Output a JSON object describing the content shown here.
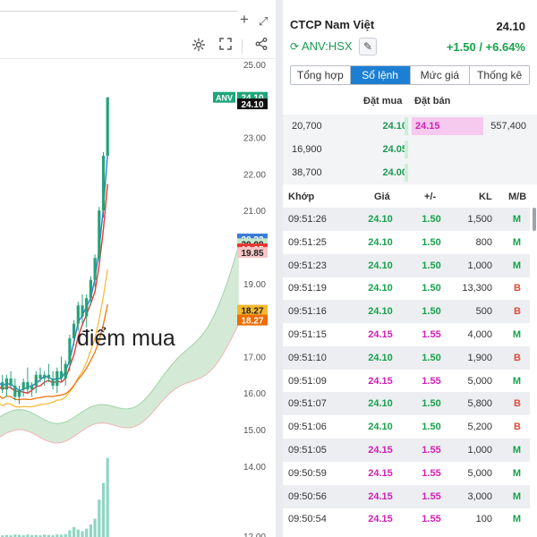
{
  "chart_area": {
    "icons": [
      "plus-icon",
      "expand-icon",
      "settings-icon",
      "fullscreen-icon",
      "share-icon"
    ],
    "annotation": "điểm mua"
  },
  "chart_data": {
    "type": "candlestick",
    "ylim": [
      12.0,
      25.0
    ],
    "y_ticks": [
      "25.00",
      "24.10",
      "23.00",
      "22.00",
      "21.00",
      "20.22",
      "20.09",
      "19.95",
      "19.85",
      "19.00",
      "18.27",
      "18.27",
      "17.00",
      "16.00",
      "15.00",
      "14.00"
    ],
    "price_labels": [
      {
        "text": "24.10",
        "value": 24.1,
        "color": "#1ea67a"
      },
      {
        "text": "24.10",
        "value": 23.92,
        "color": "#111111"
      },
      {
        "text": "20.22",
        "value": 20.22,
        "color": "#3a7bd5"
      },
      {
        "text": "20.09",
        "value": 20.09,
        "color": "#c8e6c9"
      },
      {
        "text": "19.95",
        "value": 19.95,
        "color": "#e53935"
      },
      {
        "text": "19.85",
        "value": 19.85,
        "color": "#f7c6c6"
      },
      {
        "text": "18.27",
        "value": 18.27,
        "color": "#f5b82e"
      },
      {
        "text": "18.27",
        "value": 18.0,
        "color": "#ef6c00"
      }
    ],
    "legend_tag": {
      "text": "ANV",
      "color": "#1ea67a"
    },
    "candles": [
      {
        "o": 16.1,
        "h": 16.4,
        "l": 15.9,
        "c": 16.3
      },
      {
        "o": 16.3,
        "h": 16.5,
        "l": 16.0,
        "c": 16.1
      },
      {
        "o": 16.1,
        "h": 16.5,
        "l": 15.9,
        "c": 16.4
      },
      {
        "o": 16.4,
        "h": 16.6,
        "l": 16.1,
        "c": 16.2
      },
      {
        "o": 16.2,
        "h": 16.4,
        "l": 15.8,
        "c": 15.9
      },
      {
        "o": 15.9,
        "h": 16.2,
        "l": 15.7,
        "c": 16.1
      },
      {
        "o": 16.1,
        "h": 16.4,
        "l": 15.9,
        "c": 16.3
      },
      {
        "o": 16.3,
        "h": 16.7,
        "l": 16.0,
        "c": 16.1
      },
      {
        "o": 16.1,
        "h": 16.3,
        "l": 15.9,
        "c": 16.2
      },
      {
        "o": 16.2,
        "h": 16.6,
        "l": 16.0,
        "c": 16.5
      },
      {
        "o": 16.5,
        "h": 16.7,
        "l": 16.3,
        "c": 16.4
      },
      {
        "o": 16.4,
        "h": 16.6,
        "l": 16.2,
        "c": 16.5
      },
      {
        "o": 16.5,
        "h": 16.8,
        "l": 16.3,
        "c": 16.4
      },
      {
        "o": 16.4,
        "h": 16.6,
        "l": 16.1,
        "c": 16.2
      },
      {
        "o": 16.2,
        "h": 16.7,
        "l": 16.0,
        "c": 16.6
      },
      {
        "o": 16.6,
        "h": 17.0,
        "l": 16.3,
        "c": 16.4
      },
      {
        "o": 16.4,
        "h": 16.9,
        "l": 16.2,
        "c": 16.8
      },
      {
        "o": 16.8,
        "h": 17.6,
        "l": 16.6,
        "c": 17.5
      },
      {
        "o": 17.5,
        "h": 18.0,
        "l": 17.3,
        "c": 17.9
      },
      {
        "o": 17.9,
        "h": 18.5,
        "l": 17.7,
        "c": 18.4
      },
      {
        "o": 18.4,
        "h": 18.7,
        "l": 17.9,
        "c": 18.1
      },
      {
        "o": 18.1,
        "h": 18.7,
        "l": 17.8,
        "c": 18.6
      },
      {
        "o": 18.6,
        "h": 19.2,
        "l": 18.4,
        "c": 19.1
      },
      {
        "o": 19.1,
        "h": 19.8,
        "l": 18.9,
        "c": 19.7
      },
      {
        "o": 19.7,
        "h": 21.1,
        "l": 19.6,
        "c": 21.0
      },
      {
        "o": 21.0,
        "h": 22.6,
        "l": 20.8,
        "c": 22.5
      },
      {
        "o": 22.5,
        "h": 24.1,
        "l": 22.5,
        "c": 24.1
      }
    ],
    "volumes": [
      0.3,
      0.2,
      0.25,
      0.2,
      0.3,
      0.25,
      0.2,
      0.3,
      0.22,
      0.25,
      0.2,
      0.3,
      0.25,
      0.2,
      0.3,
      0.28,
      0.35,
      0.8,
      1.2,
      0.9,
      0.7,
      1.0,
      1.5,
      2.2,
      4.5,
      6.5,
      9.5
    ]
  },
  "quote": {
    "company_name": "CTCP Nam Việt",
    "last_price": "24.10",
    "ticker": "ANV:HSX",
    "change": "+1.50 / +6.64%"
  },
  "tabs": [
    {
      "label": "Tổng hợp",
      "active": false
    },
    {
      "label": "Sổ lệnh",
      "active": true
    },
    {
      "label": "Mức giá",
      "active": false
    },
    {
      "label": "Thống kê",
      "active": false
    }
  ],
  "order_book": {
    "bid_header": "Đặt mua",
    "ask_header": "Đặt bán",
    "rows": [
      {
        "bid_qty": "20,700",
        "bid_price": "24.10",
        "ask_price": "24.15",
        "ask_qty": "557,400"
      },
      {
        "bid_qty": "16,900",
        "bid_price": "24.05",
        "ask_price": "",
        "ask_qty": ""
      },
      {
        "bid_qty": "38,700",
        "bid_price": "24.00",
        "ask_price": "",
        "ask_qty": ""
      }
    ]
  },
  "trades": {
    "headers": [
      "Khớp",
      "Giá",
      "+/-",
      "KL",
      "M/B"
    ],
    "rows": [
      {
        "time": "09:51:26",
        "price": "24.10",
        "change": "1.50",
        "volume": "1,500",
        "side": "M"
      },
      {
        "time": "09:51:25",
        "price": "24.10",
        "change": "1.50",
        "volume": "800",
        "side": "M"
      },
      {
        "time": "09:51:23",
        "price": "24.10",
        "change": "1.50",
        "volume": "1,000",
        "side": "M"
      },
      {
        "time": "09:51:19",
        "price": "24.10",
        "change": "1.50",
        "volume": "13,300",
        "side": "B"
      },
      {
        "time": "09:51:16",
        "price": "24.10",
        "change": "1.50",
        "volume": "500",
        "side": "B"
      },
      {
        "time": "09:51:15",
        "price": "24.15",
        "change": "1.55",
        "volume": "4,000",
        "side": "M"
      },
      {
        "time": "09:51:10",
        "price": "24.10",
        "change": "1.50",
        "volume": "1,900",
        "side": "B"
      },
      {
        "time": "09:51:09",
        "price": "24.15",
        "change": "1.55",
        "volume": "5,000",
        "side": "M"
      },
      {
        "time": "09:51:07",
        "price": "24.10",
        "change": "1.50",
        "volume": "5,800",
        "side": "B"
      },
      {
        "time": "09:51:06",
        "price": "24.10",
        "change": "1.50",
        "volume": "5,200",
        "side": "B"
      },
      {
        "time": "09:51:05",
        "price": "24.15",
        "change": "1.55",
        "volume": "1,000",
        "side": "M"
      },
      {
        "time": "09:50:59",
        "price": "24.15",
        "change": "1.55",
        "volume": "5,000",
        "side": "M"
      },
      {
        "time": "09:50:56",
        "price": "24.15",
        "change": "1.55",
        "volume": "3,000",
        "side": "M"
      },
      {
        "time": "09:50:54",
        "price": "24.15",
        "change": "1.55",
        "volume": "100",
        "side": "M"
      }
    ]
  },
  "colors": {
    "up": "#17a24b",
    "ceiling": "#d21fb3",
    "buy_side": "#17a24b",
    "sell_side": "#e04a3a",
    "active_tab": "#1c7fd4",
    "candle": "#26a27a"
  }
}
